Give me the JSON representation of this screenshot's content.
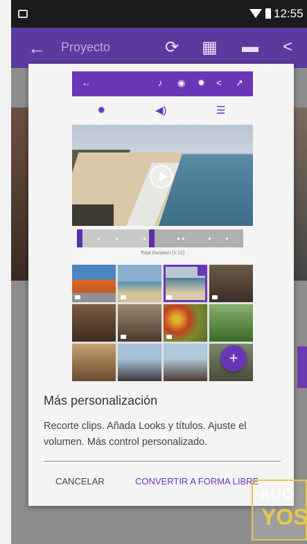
{
  "status_bar": {
    "time": "12:55"
  },
  "app_bar": {
    "back_icon": "arrow-left-icon",
    "title": "Proyecto",
    "icons": [
      "sync-icon",
      "grid-icon",
      "clapperboard-icon",
      "share-icon"
    ]
  },
  "dialog": {
    "illustration": {
      "toolbar_icons": [
        "←",
        "♪",
        "◉",
        "✹",
        "<",
        "↗"
      ],
      "tool_icons": [
        "✹",
        "◀)",
        "☰"
      ],
      "duration_label": "Total Duration (1:12)"
    },
    "heading": "Más personalización",
    "body": "Recorte clips. Añada Looks y títulos. Ajuste el volumen. Más control personalizado.",
    "actions": {
      "cancel_label": "CANCELAR",
      "convert_label": "CONVERTIR A FORMA LIBRE"
    }
  },
  "watermark": {
    "line1": "AUO",
    "line2": "YOS"
  },
  "colors": {
    "accent": "#6a36b8",
    "app_bar": "#5b3a9e",
    "status_bar": "#1b1b1b",
    "watermark_yellow": "#e8c84b"
  }
}
